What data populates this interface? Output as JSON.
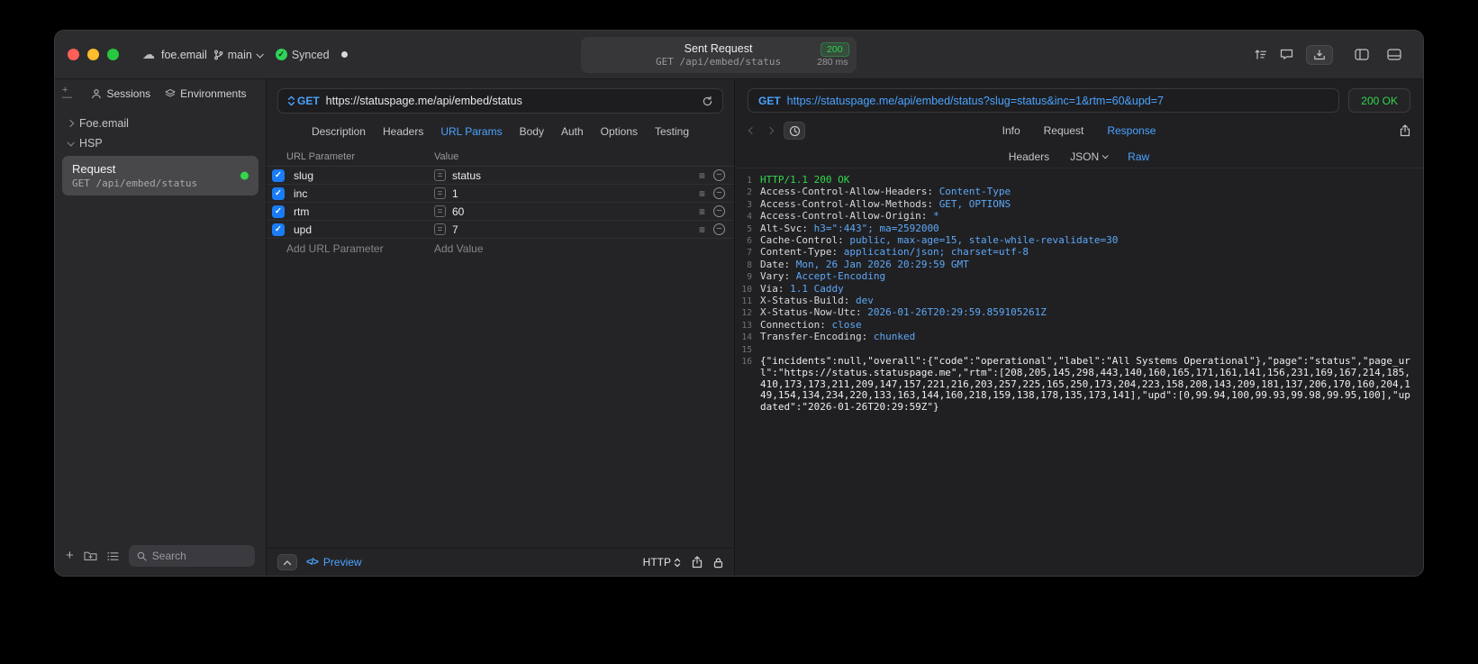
{
  "titlebar": {
    "project": "foe.email",
    "branch": "main",
    "sync_status": "Synced",
    "request_title": "Sent Request",
    "status_badge": "200",
    "request_subtitle": "GET /api/embed/status",
    "duration": "280 ms"
  },
  "sidebar": {
    "tabs": [
      "Sessions",
      "Environments"
    ],
    "tree": [
      {
        "label": "Foe.email"
      },
      {
        "label": "HSP"
      }
    ],
    "request_item": {
      "title": "Request",
      "subtitle": "GET /api/embed/status"
    },
    "search_placeholder": "Search"
  },
  "request_editor": {
    "method": "GET",
    "url": "https://statuspage.me/api/embed/status",
    "tabs": [
      "Description",
      "Headers",
      "URL Params",
      "Body",
      "Auth",
      "Options",
      "Testing"
    ],
    "active_tab": "URL Params",
    "table": {
      "col_param": "URL Parameter",
      "col_value": "Value",
      "rows": [
        {
          "name": "slug",
          "value": "status",
          "checked": true
        },
        {
          "name": "inc",
          "value": "1",
          "checked": true
        },
        {
          "name": "rtm",
          "value": "60",
          "checked": true
        },
        {
          "name": "upd",
          "value": "7",
          "checked": true
        }
      ],
      "add_param": "Add URL Parameter",
      "add_value": "Add Value"
    },
    "footer": {
      "preview": "Preview",
      "code_glyph": "</>",
      "protocol": "HTTP"
    }
  },
  "response": {
    "method": "GET",
    "url": "https://statuspage.me/api/embed/status?slug=status&inc=1&rtm=60&upd=7",
    "status": "200 OK",
    "tabs": [
      "Info",
      "Request",
      "Response"
    ],
    "active_tab": "Response",
    "subtabs": [
      "Headers",
      "JSON",
      "Raw"
    ],
    "active_subtab": "Raw",
    "lines": [
      {
        "n": "1",
        "status_line": "HTTP/1.1 200 OK"
      },
      {
        "n": "2",
        "name": "Access-Control-Allow-Headers:",
        "value": "Content-Type"
      },
      {
        "n": "3",
        "name": "Access-Control-Allow-Methods:",
        "value": "GET, OPTIONS"
      },
      {
        "n": "4",
        "name": "Access-Control-Allow-Origin:",
        "value": "*"
      },
      {
        "n": "5",
        "name": "Alt-Svc:",
        "value": "h3=\":443\"; ma=2592000"
      },
      {
        "n": "6",
        "name": "Cache-Control:",
        "value": "public, max-age=15, stale-while-revalidate=30"
      },
      {
        "n": "7",
        "name": "Content-Type:",
        "value": "application/json; charset=utf-8"
      },
      {
        "n": "8",
        "name": "Date:",
        "value": "Mon, 26 Jan 2026 20:29:59 GMT"
      },
      {
        "n": "9",
        "name": "Vary:",
        "value": "Accept-Encoding"
      },
      {
        "n": "10",
        "name": "Via:",
        "value": "1.1 Caddy"
      },
      {
        "n": "11",
        "name": "X-Status-Build:",
        "value": "dev"
      },
      {
        "n": "12",
        "name": "X-Status-Now-Utc:",
        "value": "2026-01-26T20:29:59.859105261Z"
      },
      {
        "n": "13",
        "name": "Connection:",
        "value": "close"
      },
      {
        "n": "14",
        "name": "Transfer-Encoding:",
        "value": "chunked"
      },
      {
        "n": "15"
      },
      {
        "n": "16",
        "body": "{\"incidents\":null,\"overall\":{\"code\":\"operational\",\"label\":\"All Systems Operational\"},\"page\":\"status\",\"page_url\":\"https://status.statuspage.me\",\"rtm\":[208,205,145,298,443,140,160,165,171,161,141,156,231,169,167,214,185,410,173,173,211,209,147,157,221,216,203,257,225,165,250,173,204,223,158,208,143,209,181,137,206,170,160,204,149,154,134,234,220,133,163,144,160,218,159,138,178,135,173,141],\"upd\":[0,99.94,100,99.93,99.98,99.95,100],\"updated\":\"2026-01-26T20:29:59Z\"}"
      }
    ]
  },
  "colors": {
    "accent_blue": "#4ba3ff",
    "status_green": "#32d74b",
    "checkbox_blue": "#1a7cf7"
  }
}
